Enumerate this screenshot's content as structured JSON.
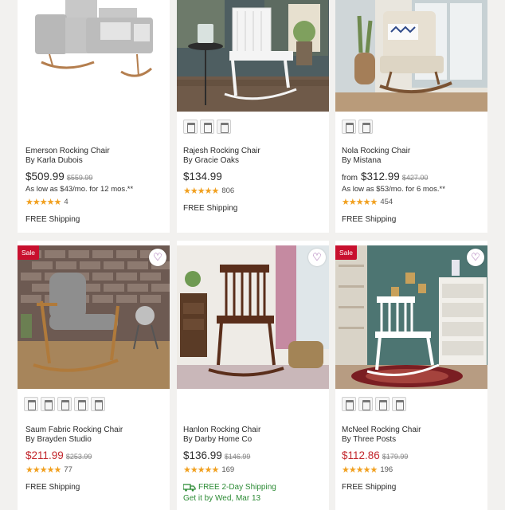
{
  "products": [
    {
      "name": "Emerson Rocking Chair",
      "by": "By Karla Dubois",
      "from": "",
      "price": "$509.99",
      "was": "$559.99",
      "financing": "As low as $43/mo. for 12 mos.**",
      "rating": 4.5,
      "stars": "★★★★★",
      "reviews": "4",
      "shipping": "FREE Shipping",
      "delivery": "",
      "sale": false,
      "swatch_count": 0
    },
    {
      "name": "Rajesh Rocking Chair",
      "by": "By Gracie Oaks",
      "from": "",
      "price": "$134.99",
      "was": "",
      "financing": "",
      "rating": 4.5,
      "stars": "★★★★★",
      "reviews": "806",
      "shipping": "FREE Shipping",
      "delivery": "",
      "sale": false,
      "swatch_count": 3
    },
    {
      "name": "Nola Rocking Chair",
      "by": "By Mistana",
      "from": "from",
      "price": "$312.99",
      "was": "$427.00",
      "financing": "As low as $53/mo. for 6 mos.**",
      "rating": 4.5,
      "stars": "★★★★★",
      "reviews": "454",
      "shipping": "FREE Shipping",
      "delivery": "",
      "sale": false,
      "swatch_count": 2
    },
    {
      "name": "Saum Fabric Rocking Chair",
      "by": "By Brayden Studio",
      "from": "",
      "price": "$211.99",
      "was": "$253.99",
      "financing": "",
      "rating": 4.5,
      "stars": "★★★★★",
      "reviews": "77",
      "shipping": "FREE Shipping",
      "delivery": "",
      "sale": true,
      "badge": "Sale",
      "swatch_count": 5
    },
    {
      "name": "Hanlon Rocking Chair",
      "by": "By Darby Home Co",
      "from": "",
      "price": "$136.99",
      "was": "$146.99",
      "financing": "",
      "rating": 4.5,
      "stars": "★★★★★",
      "reviews": "169",
      "shipping": "FREE 2-Day Shipping",
      "delivery": "Get it by Wed, Mar 13",
      "sale": false,
      "swatch_count": 0
    },
    {
      "name": "McNeel Rocking Chair",
      "by": "By Three Posts",
      "from": "",
      "price": "$112.86",
      "was": "$179.99",
      "financing": "",
      "rating": 4.5,
      "stars": "★★★★★",
      "reviews": "196",
      "shipping": "FREE Shipping",
      "delivery": "",
      "sale": true,
      "badge": "Sale",
      "swatch_count": 4
    }
  ],
  "icons": {
    "favorite": "heart-icon",
    "truck": "truck-icon",
    "star": "star-icon"
  },
  "colors": {
    "sale_price": "#c2272d",
    "sale_badge": "#c8102e",
    "stars": "#f1a01f",
    "fast_shipping": "#2c8b35",
    "heart": "#7b2a8c"
  }
}
